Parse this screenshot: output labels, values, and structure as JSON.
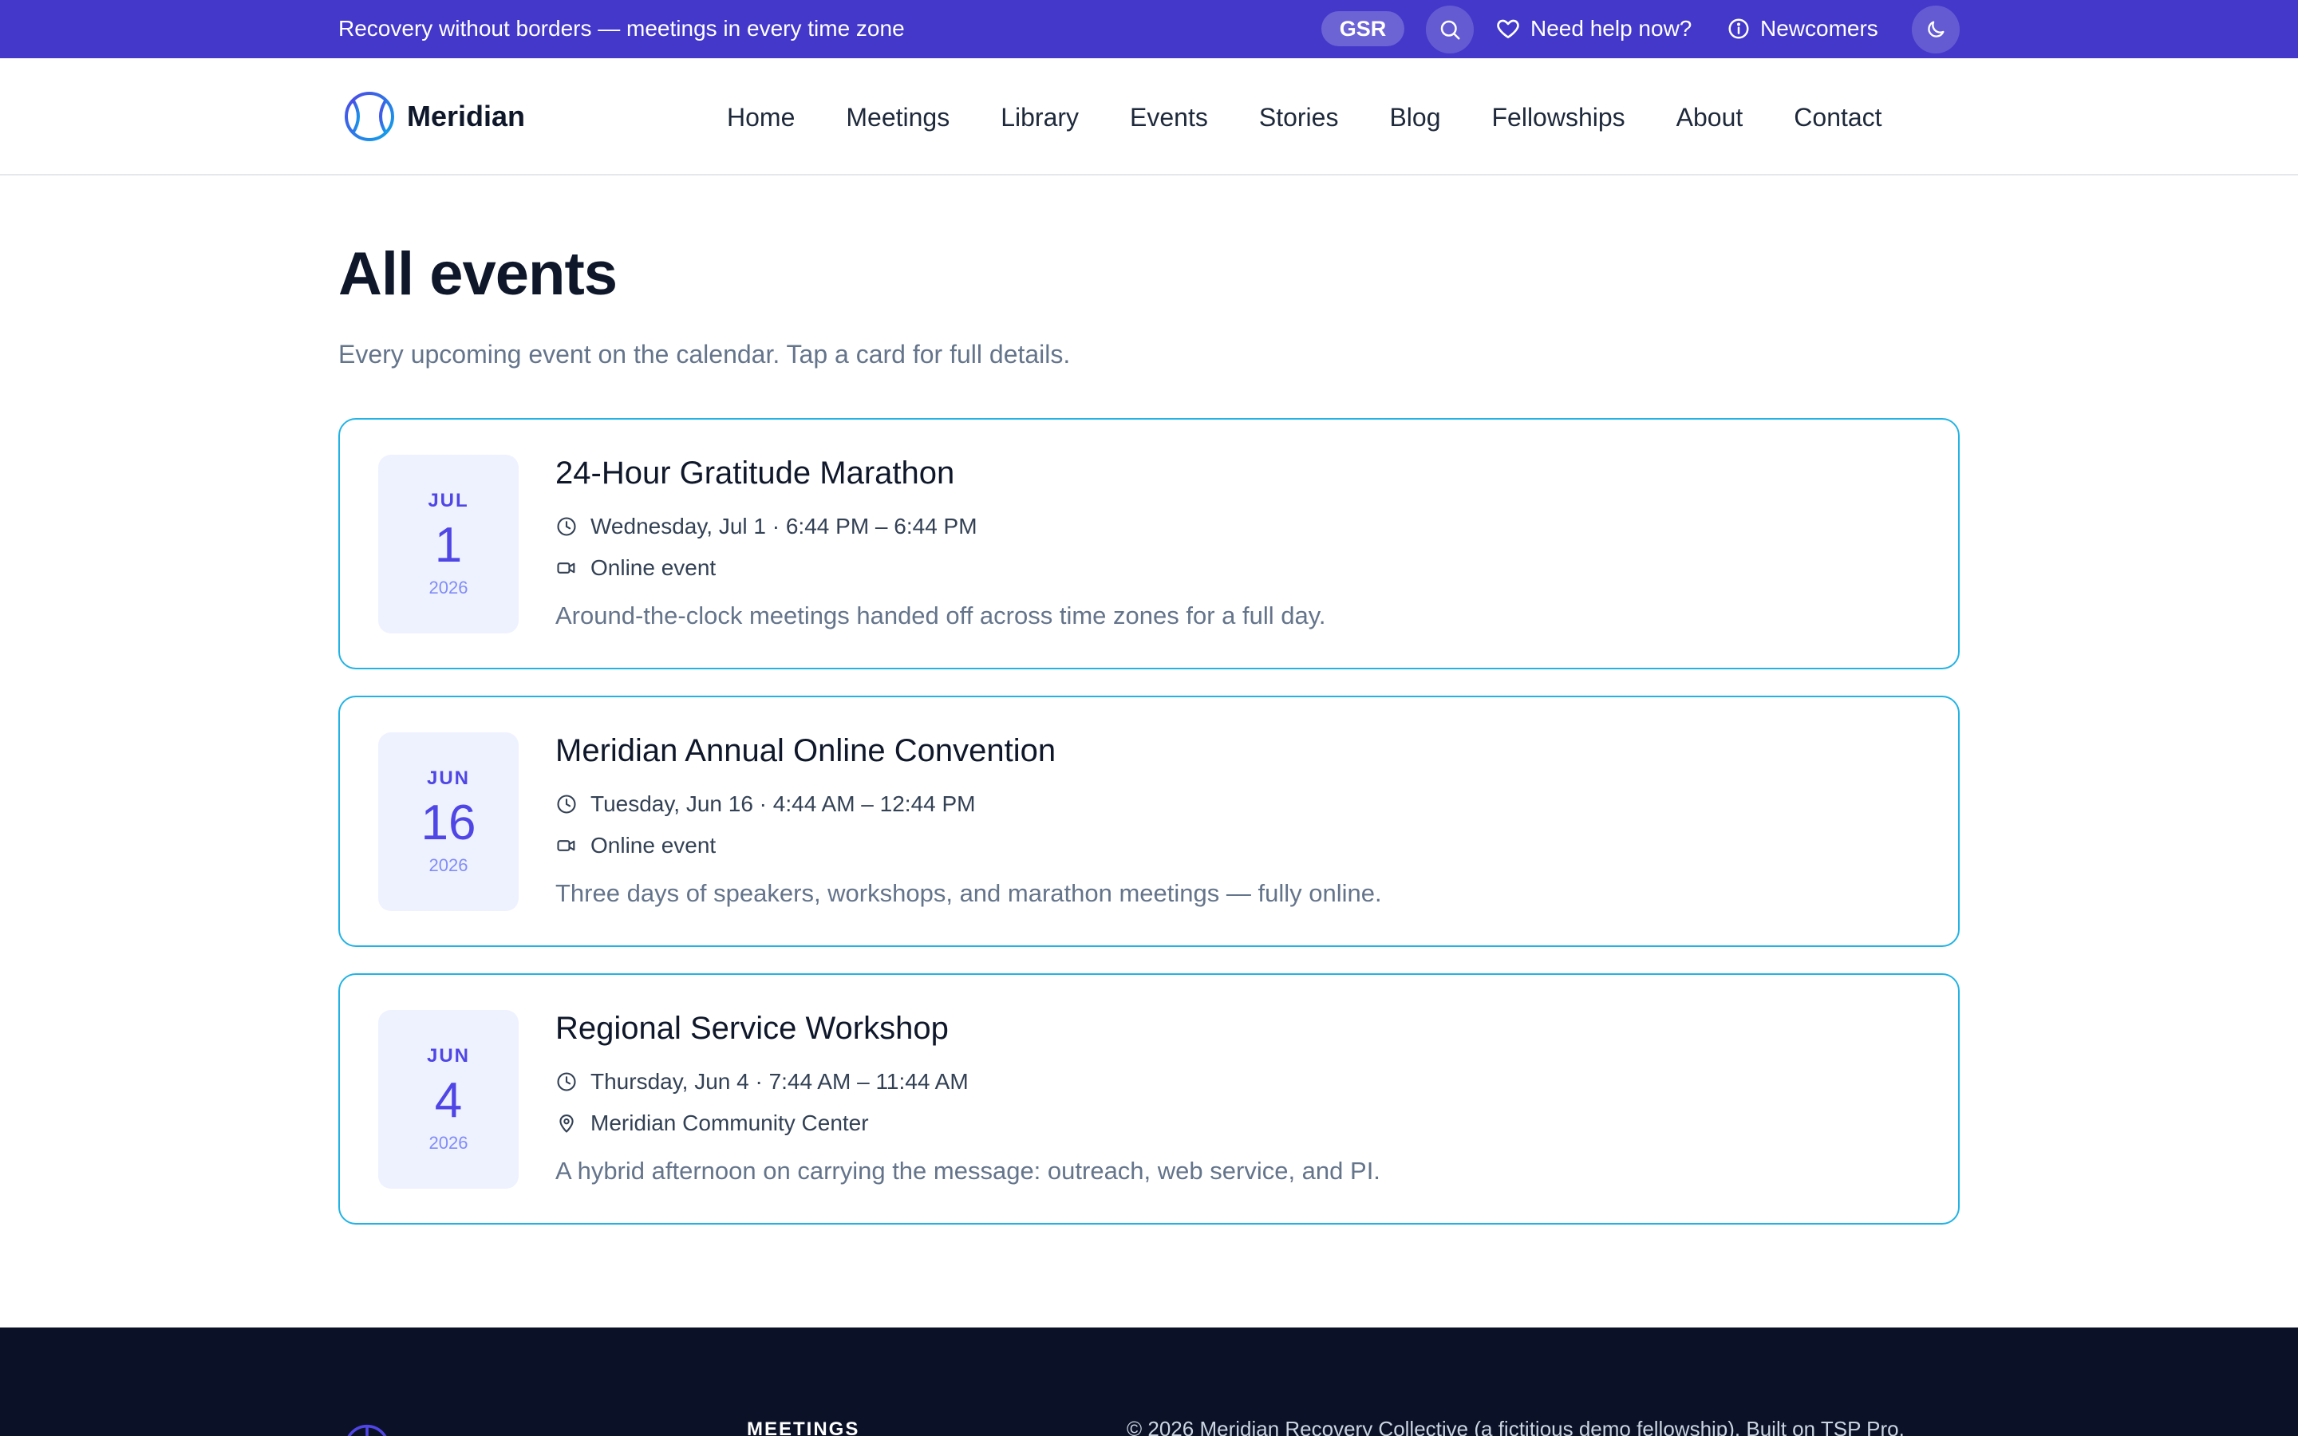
{
  "topbar": {
    "tagline": "Recovery without borders — meetings in every time zone",
    "gsr_label": "GSR",
    "help_label": "Need help now?",
    "newcomers_label": "Newcomers",
    "search_icon": "search-icon",
    "theme_icon": "moon-icon"
  },
  "brand": {
    "name": "Meridian",
    "logo_icon": "globe-logo-icon"
  },
  "nav": {
    "items": [
      {
        "label": "Home"
      },
      {
        "label": "Meetings"
      },
      {
        "label": "Library"
      },
      {
        "label": "Events"
      },
      {
        "label": "Stories"
      },
      {
        "label": "Blog"
      },
      {
        "label": "Fellowships"
      },
      {
        "label": "About"
      },
      {
        "label": "Contact"
      }
    ]
  },
  "page": {
    "title": "All events",
    "subtitle": "Every upcoming event on the calendar. Tap a card for full details."
  },
  "events": [
    {
      "month": "JUL",
      "day": "1",
      "year": "2026",
      "title": "24-Hour Gratitude Marathon",
      "when": "Wednesday, Jul 1 · 6:44 PM – 6:44 PM",
      "where": "Online event",
      "where_icon": "video-icon",
      "description": "Around-the-clock meetings handed off across time zones for a full day."
    },
    {
      "month": "JUN",
      "day": "16",
      "year": "2026",
      "title": "Meridian Annual Online Convention",
      "when": "Tuesday, Jun 16 · 4:44 AM – 12:44 PM",
      "where": "Online event",
      "where_icon": "video-icon",
      "description": "Three days of speakers, workshops, and marathon meetings — fully online."
    },
    {
      "month": "JUN",
      "day": "4",
      "year": "2026",
      "title": "Regional Service Workshop",
      "when": "Thursday, Jun 4 · 7:44 AM – 11:44 AM",
      "where": "Meridian Community Center",
      "where_icon": "map-pin-icon",
      "description": "A hybrid afternoon on carrying the message: outreach, web service, and PI."
    }
  ],
  "footer": {
    "meetings_heading": "MEETINGS",
    "copyright": "© 2026 Meridian Recovery Collective (a fictitious demo fellowship). Built on TSP Pro."
  },
  "colors": {
    "topbar": "#4338ca",
    "accent": "#4f46e5",
    "card_border": "#22b3e4",
    "footer": "#0b1127"
  }
}
